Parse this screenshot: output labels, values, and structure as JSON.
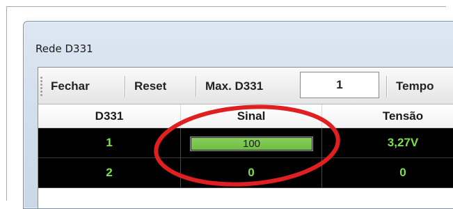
{
  "window": {
    "title": "Rede D331"
  },
  "toolbar": {
    "close_label": "Fechar",
    "reset_label": "Reset",
    "max_label": "Max. D331",
    "max_value": "1",
    "time_label": "Tempo"
  },
  "grid": {
    "columns": [
      "D331",
      "Sinal",
      "Tensão"
    ],
    "rows": [
      {
        "id": "1",
        "signal": "100",
        "signal_level": 1.0,
        "voltage": "3,27V"
      },
      {
        "id": "2",
        "signal": "0",
        "signal_level": 0.0,
        "voltage": "0"
      }
    ]
  },
  "colors": {
    "row_background": "#000000",
    "row_text": "#7ee04a",
    "signal_fill": "#6fbd44",
    "annotation": "#e02020"
  },
  "annotation": {
    "shape": "circle",
    "target": "signal-column-header-and-first-row"
  }
}
